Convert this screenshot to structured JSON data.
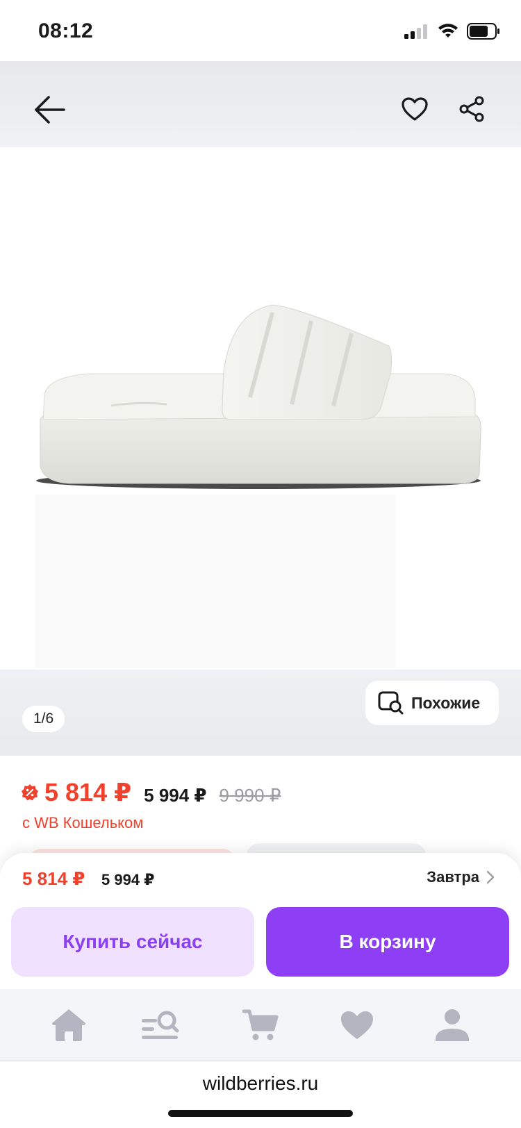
{
  "status_bar": {
    "time": "08:12"
  },
  "gallery": {
    "counter": "1/6",
    "similar_label": "Похожие"
  },
  "price": {
    "wallet_price": "5 814 ₽",
    "regular_price": "5 994 ₽",
    "old_price": "9 990 ₽",
    "wallet_note": "с WB Кошельком"
  },
  "sheet": {
    "wallet_price": "5 814 ₽",
    "regular_price": "5 994 ₽",
    "delivery": "Завтра",
    "buy_now_label": "Купить сейчас",
    "cart_label": "В корзину"
  },
  "tabs": [
    {
      "icon": "home-icon"
    },
    {
      "icon": "catalog-search-icon"
    },
    {
      "icon": "cart-icon"
    },
    {
      "icon": "favorites-heart-icon"
    },
    {
      "icon": "profile-icon"
    }
  ],
  "browser": {
    "url": "wildberries.ru"
  },
  "colors": {
    "accent": "#8e3ff6",
    "accent_light": "#efe1ff",
    "price_red": "#f0412c",
    "tab_icon": "#b4b5c0"
  }
}
